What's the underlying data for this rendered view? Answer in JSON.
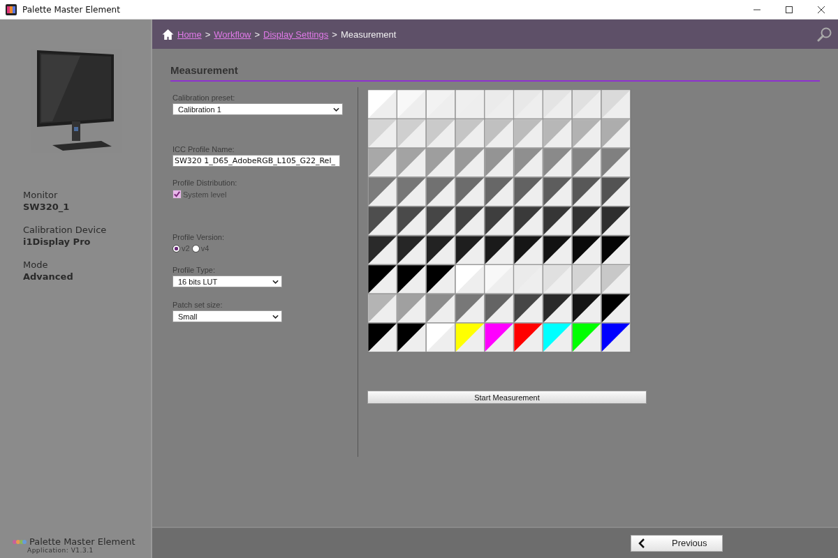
{
  "window": {
    "title": "Palette Master Element"
  },
  "sidebar": {
    "info": [
      {
        "label": "Monitor",
        "value": "SW320_1"
      },
      {
        "label": "Calibration Device",
        "value": "i1Display Pro"
      },
      {
        "label": "Mode",
        "value": "Advanced"
      }
    ],
    "app_name": "Palette Master Element",
    "version": "Application: V1.3.1"
  },
  "breadcrumb": {
    "separator": ">",
    "items": [
      {
        "label": "Home",
        "link": true
      },
      {
        "label": "Workflow",
        "link": true
      },
      {
        "label": "Display Settings",
        "link": true
      },
      {
        "label": "Measurement",
        "link": false
      }
    ]
  },
  "page_title": "Measurement",
  "form": {
    "calibration_preset": {
      "label": "Calibration preset:",
      "value": "Calibration 1"
    },
    "icc_profile_name": {
      "label": "ICC Profile Name:",
      "value": "SW320 1_D65_AdobeRGB_L105_G22_Rel_"
    },
    "profile_distribution": {
      "label": "Profile Distribution:",
      "option": "System level",
      "checked": true
    },
    "profile_version": {
      "label": "Profile Version:",
      "options": [
        {
          "label": "v2",
          "selected": true
        },
        {
          "label": "v4",
          "selected": false
        }
      ]
    },
    "profile_type": {
      "label": "Profile Type:",
      "value": "16 bits LUT"
    },
    "patch_set_size": {
      "label": "Patch set size:",
      "value": "Small"
    }
  },
  "patch_grid": {
    "rows": [
      [
        {
          "color": "#ffffff"
        },
        {
          "color": "#f8f8f8"
        },
        {
          "color": "#f2f2f2"
        },
        {
          "color": "#efefef"
        },
        {
          "color": "#ebebeb"
        },
        {
          "color": "#e8e8e8"
        },
        {
          "color": "#e4e4e4"
        },
        {
          "color": "#e0e0e0"
        },
        {
          "color": "#dadada"
        }
      ],
      [
        {
          "color": "#d4d4d4"
        },
        {
          "color": "#cfcfcf"
        },
        {
          "color": "#cacaca"
        },
        {
          "color": "#c5c5c5"
        },
        {
          "color": "#c0c0c0"
        },
        {
          "color": "#bcbcbc"
        },
        {
          "color": "#b7b7b7"
        },
        {
          "color": "#b2b2b2"
        },
        {
          "color": "#adadad"
        }
      ],
      [
        {
          "color": "#a8a8a8"
        },
        {
          "color": "#a3a3a3"
        },
        {
          "color": "#9e9e9e"
        },
        {
          "color": "#999999"
        },
        {
          "color": "#949494"
        },
        {
          "color": "#8f8f8f"
        },
        {
          "color": "#8a8a8a"
        },
        {
          "color": "#858585"
        },
        {
          "color": "#808080"
        }
      ],
      [
        {
          "color": "#7b7b7b"
        },
        {
          "color": "#767676"
        },
        {
          "color": "#717171"
        },
        {
          "color": "#6c6c6c"
        },
        {
          "color": "#676767"
        },
        {
          "color": "#626262"
        },
        {
          "color": "#5d5d5d"
        },
        {
          "color": "#585858"
        },
        {
          "color": "#535353"
        }
      ],
      [
        {
          "color": "#4e4e4e"
        },
        {
          "color": "#4a4a4a"
        },
        {
          "color": "#464646"
        },
        {
          "color": "#424242"
        },
        {
          "color": "#3e3e3e"
        },
        {
          "color": "#3a3a3a"
        },
        {
          "color": "#363636"
        },
        {
          "color": "#323232"
        },
        {
          "color": "#2e2e2e"
        }
      ],
      [
        {
          "color": "#2a2a2a"
        },
        {
          "color": "#262626"
        },
        {
          "color": "#222222"
        },
        {
          "color": "#1e1e1e"
        },
        {
          "color": "#1a1a1a"
        },
        {
          "color": "#161616"
        },
        {
          "color": "#121212"
        },
        {
          "color": "#0a0a0a"
        },
        {
          "color": "#050505"
        }
      ],
      [
        {
          "color": "#000000"
        },
        {
          "color": "#000000"
        },
        {
          "color": "#000000"
        },
        {
          "color": "#ffffff"
        },
        {
          "color": "#f8f8f8"
        },
        {
          "color": "#ebebeb"
        },
        {
          "color": "#e0e0e0"
        },
        {
          "color": "#d4d4d4"
        },
        {
          "color": "#c8c8c8"
        }
      ],
      [
        {
          "color": "#b4b4b4"
        },
        {
          "color": "#a0a0a0"
        },
        {
          "color": "#8c8c8c"
        },
        {
          "color": "#787878"
        },
        {
          "color": "#646464"
        },
        {
          "color": "#464646"
        },
        {
          "color": "#2a2a2a"
        },
        {
          "color": "#141414"
        },
        {
          "color": "#000000"
        }
      ],
      [
        {
          "color": "#000000"
        },
        {
          "color": "#000000"
        },
        {
          "color": "#ffffff"
        },
        {
          "color": "#ffff00"
        },
        {
          "color": "#ff00ff"
        },
        {
          "color": "#ff0000"
        },
        {
          "color": "#00ffff"
        },
        {
          "color": "#00ff00"
        },
        {
          "color": "#0000ff"
        }
      ]
    ]
  },
  "start_button": "Start Measurement",
  "previous_button": "Previous"
}
